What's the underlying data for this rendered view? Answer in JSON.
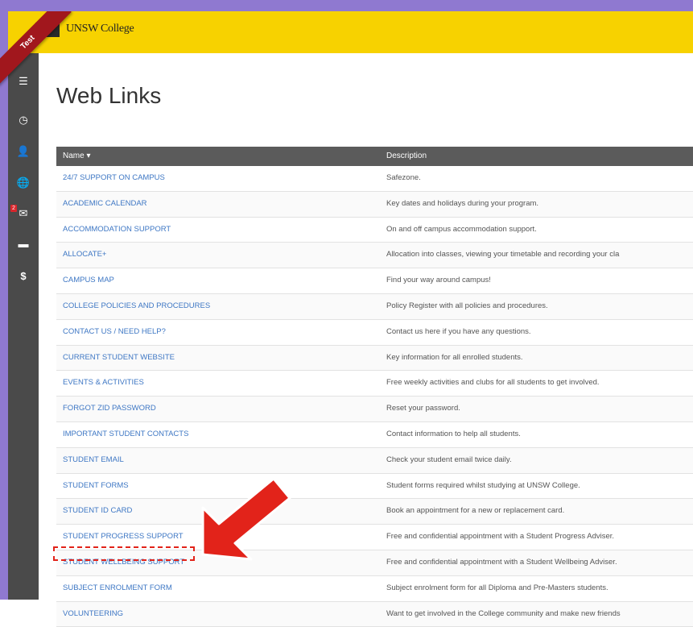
{
  "header": {
    "logo_text": "UNSW College",
    "ribbon_label": "Test"
  },
  "sidebar": {
    "items": [
      {
        "icon": "menu-icon",
        "glyph": "☰"
      },
      {
        "icon": "clock-icon",
        "glyph": "◷"
      },
      {
        "icon": "user-icon",
        "glyph": "👤"
      },
      {
        "icon": "globe-icon",
        "glyph": "🌐"
      },
      {
        "icon": "mail-icon",
        "glyph": "✉",
        "badge": "2"
      },
      {
        "icon": "folder-icon",
        "glyph": "▬"
      },
      {
        "icon": "dollar-icon",
        "glyph": "$"
      }
    ]
  },
  "page": {
    "title": "Web Links"
  },
  "table": {
    "headers": {
      "name": "Name ▾",
      "description": "Description"
    },
    "rows": [
      {
        "name": "24/7 Support on Campus",
        "description": "Safezone."
      },
      {
        "name": "Academic Calendar",
        "description": "Key dates and holidays during your program."
      },
      {
        "name": "Accommodation Support",
        "description": "On and off campus accommodation support."
      },
      {
        "name": "Allocate+",
        "description": "Allocation into classes, viewing your timetable and recording your cla"
      },
      {
        "name": "Campus Map",
        "description": "Find your way around campus!"
      },
      {
        "name": "College Policies and Procedures",
        "description": "Policy Register with all policies and procedures."
      },
      {
        "name": "Contact Us / Need Help?",
        "description": "Contact us here if you have any questions."
      },
      {
        "name": "Current Student Website",
        "description": "Key information for all enrolled students."
      },
      {
        "name": "Events & Activities",
        "description": "Free weekly activities and clubs for all students to get involved."
      },
      {
        "name": "Forgot zID Password",
        "description": "Reset your password."
      },
      {
        "name": "Important Student Contacts",
        "description": "Contact information to help all students."
      },
      {
        "name": "Student Email",
        "description": "Check your student email twice daily."
      },
      {
        "name": "Student Forms",
        "description": "Student forms required whilst studying at UNSW College."
      },
      {
        "name": "Student ID Card",
        "description": "Book an appointment for a new or replacement card."
      },
      {
        "name": "Student Progress Support",
        "description": "Free and confidential appointment with a Student Progress Adviser."
      },
      {
        "name": "Student Wellbeing Support",
        "description": "Free and confidential appointment with a Student Wellbeing Adviser."
      },
      {
        "name": "Subject Enrolment Form",
        "description": "Subject enrolment form for all Diploma and Pre-Masters students."
      },
      {
        "name": "Volunteering",
        "description": "Want to get involved in the College community and make new friends"
      }
    ]
  },
  "colors": {
    "topbar": "#f7d200",
    "sidebar": "#4a4a4a",
    "link": "#3e77c4",
    "accent": "#e2231a"
  }
}
